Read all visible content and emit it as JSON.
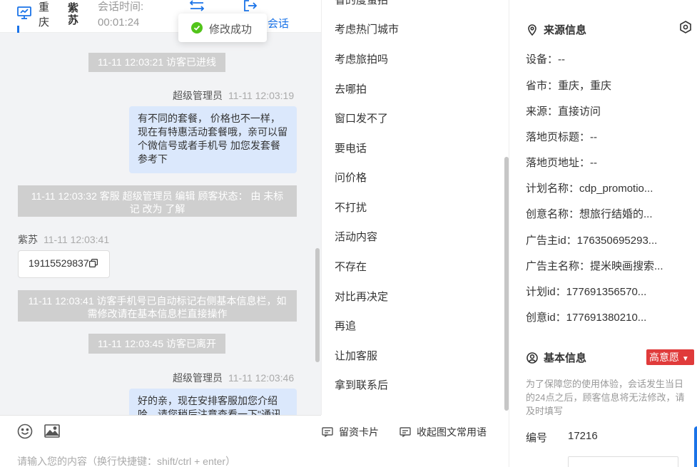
{
  "header": {
    "city": "重庆",
    "visitor_name": "紫苏",
    "session_time_label": "会话时间:",
    "session_time_value": "00:01:24",
    "session_label": "会话"
  },
  "toast": {
    "text": "修改成功"
  },
  "messages": {
    "sys1": "11-11 12:03:21 访客已进线",
    "agent1_sender": "超级管理员",
    "agent1_time": "11-11 12:03:19",
    "agent1_text": "有不同的套餐， 价格也不一样，现在有特惠活动套餐哦，亲可以留个微信号或者手机号 加您发套餐参考下",
    "sys2": "11-11 12:03:32 客服 超级管理员 编辑 顾客状态： 由 未标记 改为 了解",
    "visitor_sender": "紫苏",
    "visitor_time": "11-11 12:03:41",
    "visitor_text": "19115529837",
    "sys3": "11-11 12:03:41 访客手机号已自动标记右侧基本信息栏，如需修改请在基本信息栏直接操作",
    "sys4": "11-11 12:03:45 访客已离开",
    "agent2_sender": "超级管理员",
    "agent2_time": "11-11 12:03:46",
    "agent2_text": "好的亲，现在安排客服加您介绍哈，请您稍后注意查看一下\"通讯"
  },
  "composer": {
    "placeholder": "请输入您的内容（换行快捷键：shift/ctrl + enter）",
    "card_button": "留资卡片",
    "collapse_button": "收起图文常用语"
  },
  "phrases": {
    "top_partial": "省的度蜜拍",
    "items": [
      "考虑热门城市",
      "考虑旅拍吗",
      "去哪拍",
      "窗口发不了",
      "要电话",
      "问价格",
      "不打扰",
      "活动内容",
      "不存在",
      "对比再决定",
      "再追",
      "让加客服",
      "拿到联系后"
    ]
  },
  "info": {
    "source_title": "来源信息",
    "rows": [
      "设备：--",
      "省市：重庆，重庆",
      "来源：直接访问",
      "落地页标题：--",
      "落地页地址：--",
      "计划名称：cdp_promotio...",
      "创意名称：想旅行结婚的...",
      "广告主id：176350695293...",
      "广告主名称：提米映画搜索...",
      "计划id：177691356570...",
      "创意id：177691380210..."
    ],
    "basic_title": "基本信息",
    "intent_badge": "高意愿",
    "note": "为了保障您的使用体验，会话发生当日的24点之后，顾客信息将无法修改，请及时填写",
    "id_label": "编号",
    "id_value": "17216"
  },
  "colors": {
    "accent": "#1a73e8",
    "badge": "#e03b3b",
    "bubble_agent": "#dbe8fc",
    "system_msg": "#cfcfcf"
  }
}
